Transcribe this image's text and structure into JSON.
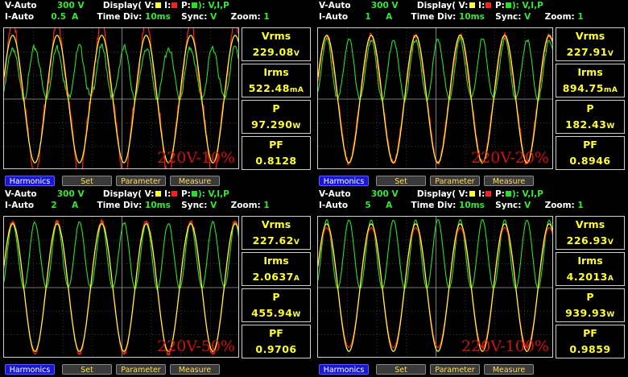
{
  "colors": {
    "voltage": "#ffff33",
    "current": "#ff2020",
    "power": "#28e028"
  },
  "panels": [
    {
      "v_mode": "V-Auto",
      "v_range": "300",
      "v_unit": "V",
      "i_mode": "I-Auto",
      "i_range": "0.5",
      "i_unit": "A",
      "display_label": "Display( V:",
      "display_i": "I:",
      "display_p": "P:",
      "display_value": "): V,I,P",
      "timediv_label": "Time Div:",
      "timediv_value": "10ms",
      "sync_label": "Sync:",
      "sync_value": "V",
      "zoom_label": "Zoom:",
      "zoom_value": "1",
      "trace_tag": "220V-10%",
      "wave": {
        "voltage_amp": 0.45,
        "current_amp": 0.62,
        "current_distortion": 0.55,
        "power_amp": 0.32
      },
      "meters": [
        {
          "label": "Vrms",
          "value": "229.08",
          "unit": "V"
        },
        {
          "label": "Irms",
          "value": "522.48",
          "unit": "mA"
        },
        {
          "label": "P",
          "value": "97.290",
          "unit": "W"
        },
        {
          "label": "PF",
          "value": "0.8128",
          "unit": ""
        }
      ],
      "buttons": [
        "Harmonics",
        "Set",
        "Parameter",
        "Measure"
      ]
    },
    {
      "v_mode": "V-Auto",
      "v_range": "300",
      "v_unit": "V",
      "i_mode": "I-Auto",
      "i_range": "1",
      "i_unit": "A",
      "display_label": "Display( V:",
      "display_i": "I:",
      "display_p": "P:",
      "display_value": "): V,I,P",
      "timediv_label": "Time Div:",
      "timediv_value": "10ms",
      "sync_label": "Sync:",
      "sync_value": "V",
      "zoom_label": "Zoom:",
      "zoom_value": "1",
      "trace_tag": "220V-20%",
      "wave": {
        "voltage_amp": 0.45,
        "current_amp": 0.5,
        "current_distortion": 0.35,
        "power_amp": 0.38
      },
      "meters": [
        {
          "label": "Vrms",
          "value": "227.91",
          "unit": "V"
        },
        {
          "label": "Irms",
          "value": "894.75",
          "unit": "mA"
        },
        {
          "label": "P",
          "value": "182.43",
          "unit": "W"
        },
        {
          "label": "PF",
          "value": "0.8946",
          "unit": ""
        }
      ],
      "buttons": [
        "Harmonics",
        "Set",
        "Parameter",
        "Measure"
      ]
    },
    {
      "v_mode": "V-Auto",
      "v_range": "300",
      "v_unit": "V",
      "i_mode": "I-Auto",
      "i_range": "2",
      "i_unit": "A",
      "display_label": "Display( V:",
      "display_i": "I:",
      "display_p": "P:",
      "display_value": "): V,I,P",
      "timediv_label": "Time Div:",
      "timediv_value": "10ms",
      "sync_label": "Sync:",
      "sync_value": "V",
      "zoom_label": "Zoom:",
      "zoom_value": "1",
      "trace_tag": "220V-50%",
      "wave": {
        "voltage_amp": 0.45,
        "current_amp": 0.52,
        "current_distortion": 0.2,
        "power_amp": 0.42
      },
      "meters": [
        {
          "label": "Vrms",
          "value": "227.62",
          "unit": "V"
        },
        {
          "label": "Irms",
          "value": "2.0637",
          "unit": "A"
        },
        {
          "label": "P",
          "value": "455.94",
          "unit": "W"
        },
        {
          "label": "PF",
          "value": "0.9706",
          "unit": ""
        }
      ],
      "buttons": [
        "Harmonics",
        "Set",
        "Parameter",
        "Measure"
      ]
    },
    {
      "v_mode": "V-Auto",
      "v_range": "300",
      "v_unit": "V",
      "i_mode": "I-Auto",
      "i_range": "5",
      "i_unit": "A",
      "display_label": "Display( V:",
      "display_i": "I:",
      "display_p": "P:",
      "display_value": "): V,I,P",
      "timediv_label": "Time Div:",
      "timediv_value": "10ms",
      "sync_label": "Sync:",
      "sync_value": "V",
      "zoom_label": "Zoom:",
      "zoom_value": "1",
      "trace_tag": "220V-100%",
      "wave": {
        "voltage_amp": 0.45,
        "current_amp": 0.47,
        "current_distortion": 0.06,
        "power_amp": 0.44
      },
      "meters": [
        {
          "label": "Vrms",
          "value": "226.93",
          "unit": "V"
        },
        {
          "label": "Irms",
          "value": "4.2013",
          "unit": "A"
        },
        {
          "label": "P",
          "value": "939.93",
          "unit": "W"
        },
        {
          "label": "PF",
          "value": "0.9859",
          "unit": ""
        }
      ],
      "buttons": [
        "Harmonics",
        "Set",
        "Parameter",
        "Measure"
      ]
    }
  ]
}
